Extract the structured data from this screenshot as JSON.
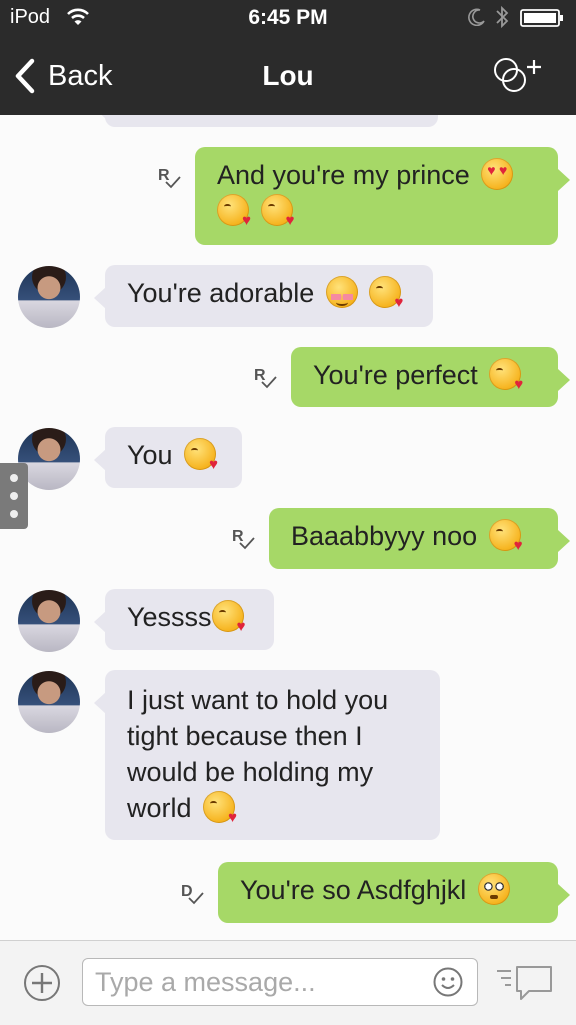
{
  "status_bar": {
    "carrier": "iPod",
    "time": "6:45 PM"
  },
  "nav": {
    "back_label": "Back",
    "title": "Lou"
  },
  "messages": [
    {
      "direction": "out",
      "receipt": "R",
      "text": "And you're my prince",
      "emojis": [
        "heart-eyes",
        "kiss",
        "kiss"
      ]
    },
    {
      "direction": "in",
      "text": "You're adorable",
      "emojis": [
        "blush",
        "kiss"
      ]
    },
    {
      "direction": "out",
      "receipt": "R",
      "text": "You're perfect",
      "emojis": [
        "kiss"
      ]
    },
    {
      "direction": "in",
      "text": "You",
      "emojis": [
        "kiss"
      ]
    },
    {
      "direction": "out",
      "receipt": "R",
      "text": "Baaabbyyy noo",
      "emojis": [
        "kiss"
      ]
    },
    {
      "direction": "in",
      "text": "Yessss",
      "emojis": [
        "kiss"
      ]
    },
    {
      "direction": "in",
      "text": "I just want to hold you tight because then I would be holding my world",
      "emojis": [
        "kiss"
      ]
    },
    {
      "direction": "out",
      "receipt": "D",
      "text": "You're so Asdfghjkl",
      "emojis": [
        "flushed"
      ]
    }
  ],
  "input": {
    "placeholder": "Type a message..."
  },
  "colors": {
    "nav_background": "#2b2b2b",
    "outgoing_bubble": "#a6d867",
    "incoming_bubble": "#e7e6ee"
  }
}
